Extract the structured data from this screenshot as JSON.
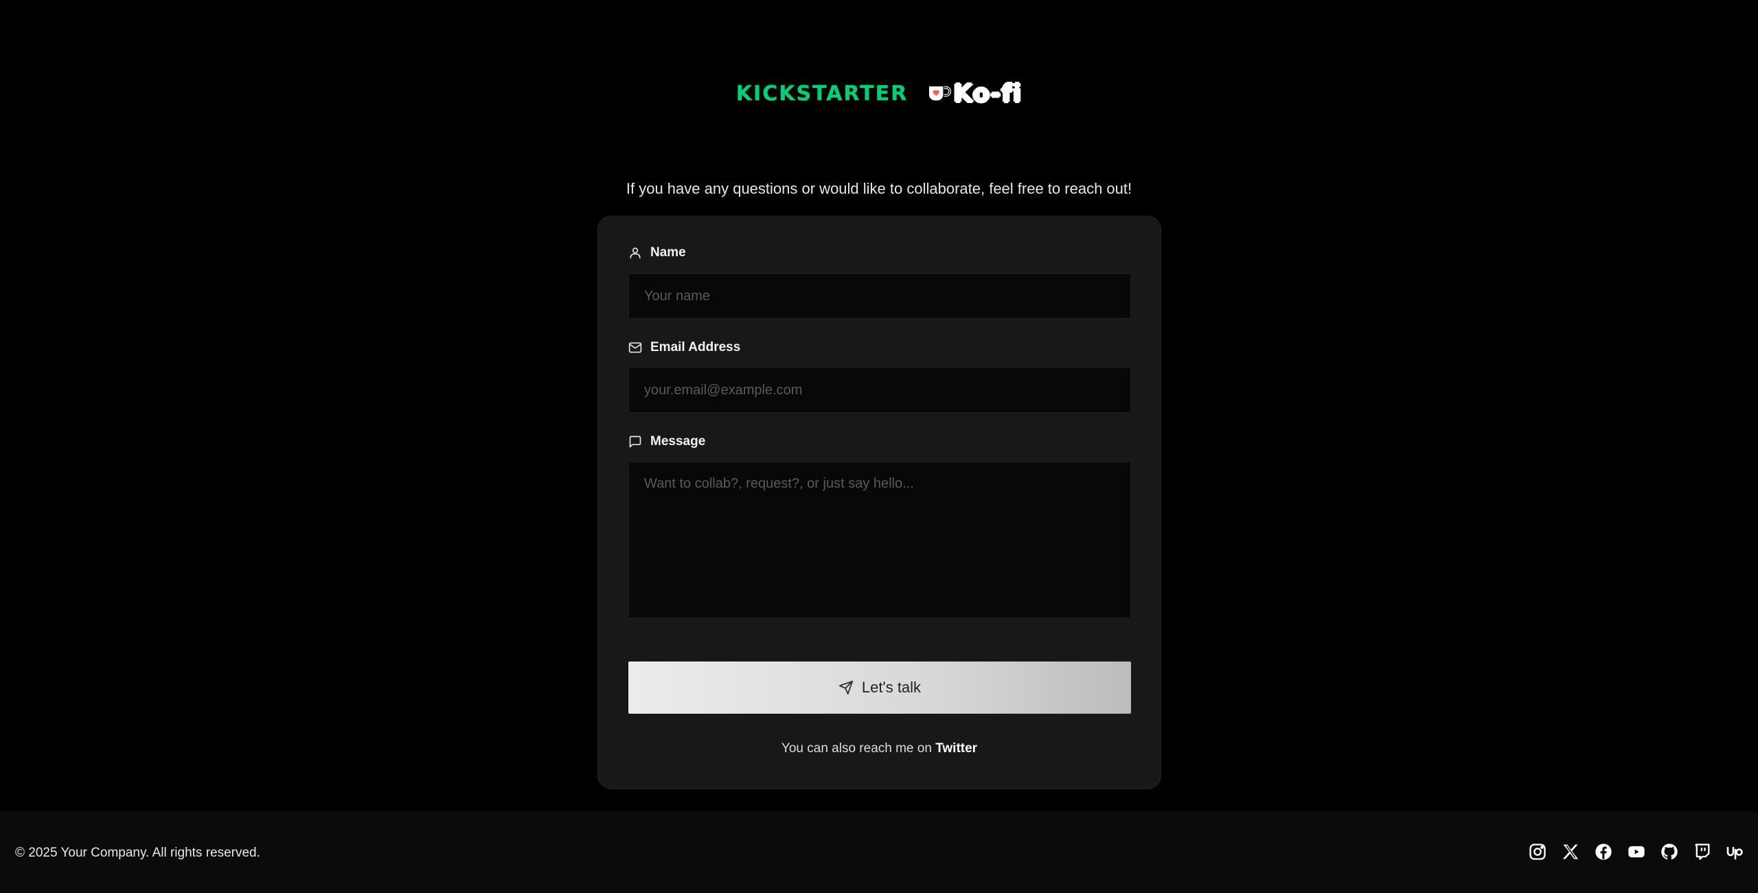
{
  "brand": {
    "kickstarter_logo": "KICKSTARTER",
    "kofi_logo": "Ko-fi",
    "kickstarter_color": "#05ce78",
    "kofi_cup_color": "#ff5e5b"
  },
  "intro_text": "If you have any questions or would like to collaborate, feel free to reach out!",
  "form": {
    "name": {
      "label": "Name",
      "placeholder": "Your name",
      "icon": "user-icon"
    },
    "email": {
      "label": "Email Address",
      "placeholder": "your.email@example.com",
      "icon": "mail-icon"
    },
    "message": {
      "label": "Message",
      "placeholder": "Want to collab?, request?, or just say hello...",
      "icon": "message-square-icon"
    },
    "submit_label": "Let's talk",
    "submit_icon": "send-icon"
  },
  "alt_contact": {
    "prefix": "You can also reach me on",
    "link_label": "Twitter"
  },
  "footer": {
    "copyright": "© 2025 Your Company. All rights reserved.",
    "socials": [
      "instagram-icon",
      "x-icon",
      "facebook-icon",
      "youtube-icon",
      "github-icon",
      "twitch-icon",
      "upwork-icon"
    ]
  }
}
